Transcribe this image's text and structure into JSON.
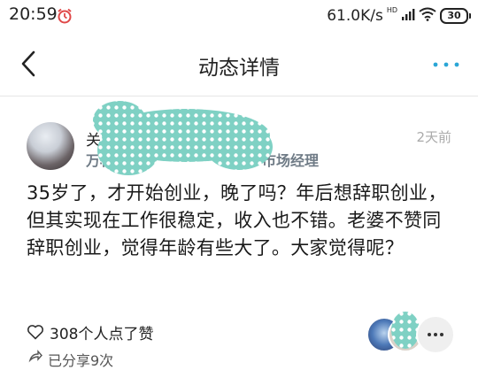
{
  "status_bar": {
    "time": "20:59",
    "alarm_icon": "alarm-clock-icon",
    "net_speed": "61.0K/s",
    "hd_label": "HD",
    "signal_icon": "signal-icon",
    "wifi_icon": "wifi-icon",
    "battery_level": "30"
  },
  "nav": {
    "back_icon": "chevron-left-icon",
    "title": "动态详情",
    "more_icon": "more-dots-icon"
  },
  "post": {
    "author_initial": "关",
    "author_subtitle_head": "万科",
    "author_subtitle_tail": "市场经理",
    "time": "2天前",
    "body": "35岁了，才开始创业，晚了吗？年后想辞职创业，但其实现在工作很稳定，收入也不错。老婆不赞同辞职创业，觉得年龄有些大了。大家觉得呢？"
  },
  "likes": {
    "icon": "heart-outline-icon",
    "text": "308个人点了赞"
  },
  "shares": {
    "text": "已分享9次"
  },
  "colors": {
    "privacy_blob": "#7fd1c4",
    "subtitle": "#6f7b86",
    "accent": "#2aa6d6"
  }
}
